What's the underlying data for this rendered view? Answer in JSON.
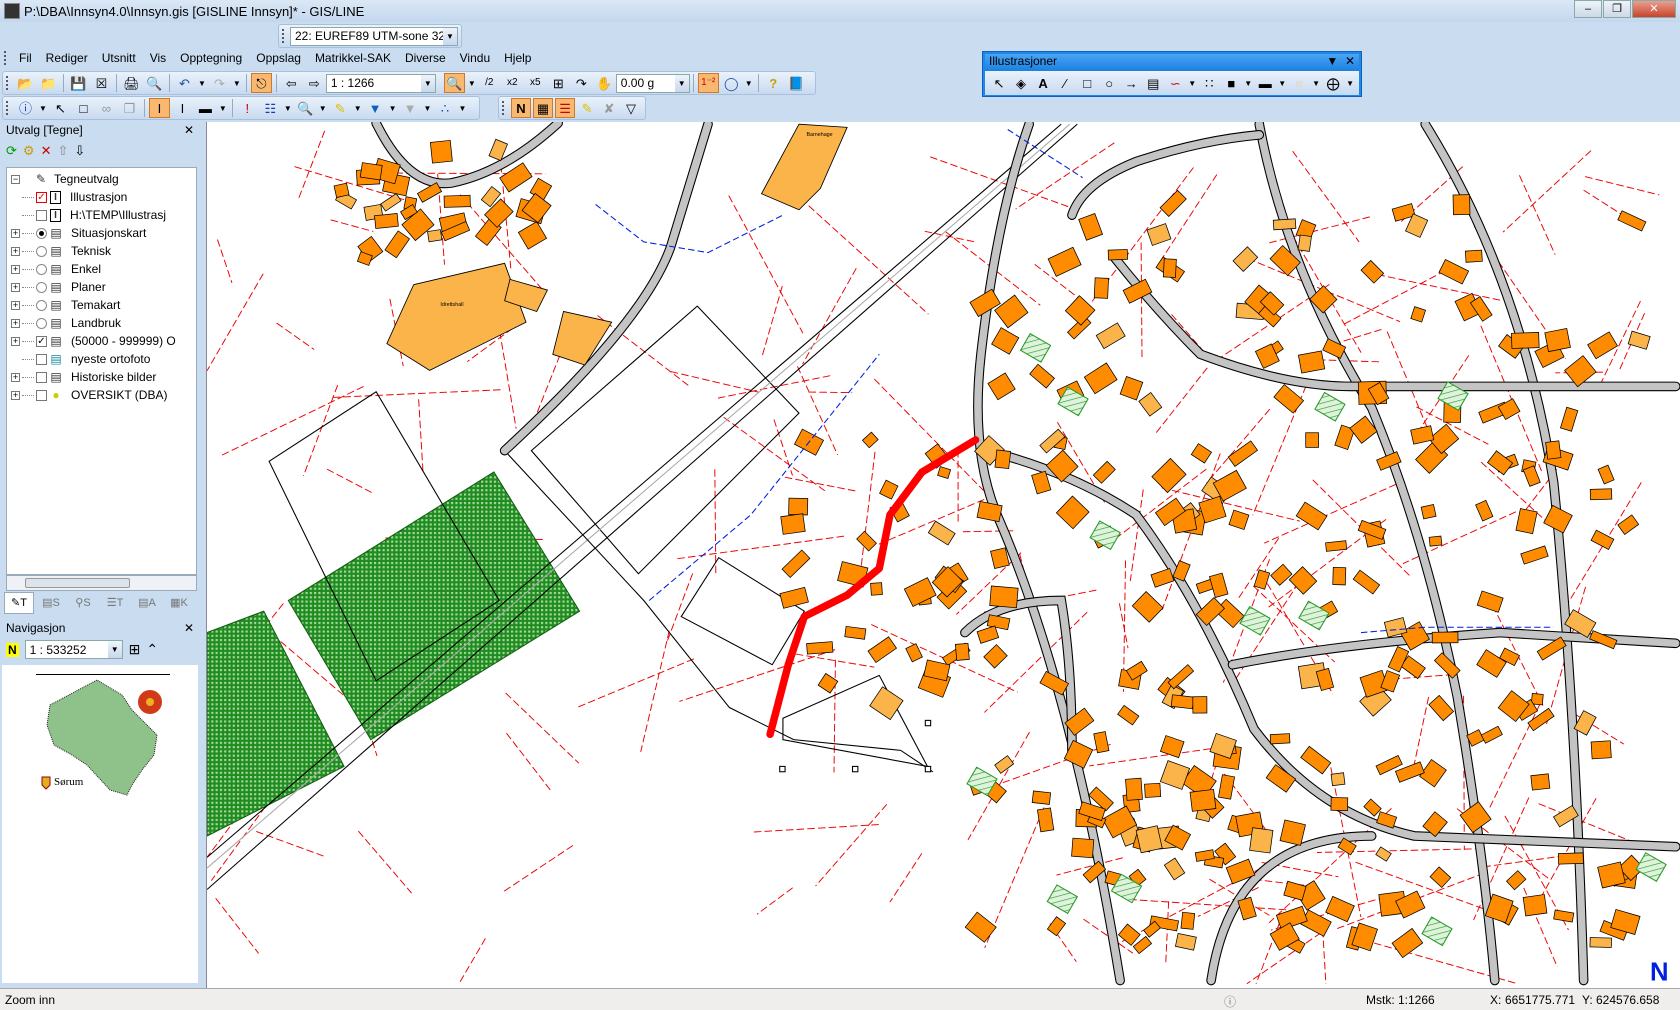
{
  "window": {
    "title": "P:\\DBA\\Innsyn4.0\\Innsyn.gis [GISLINE Innsyn]* - GIS/LINE"
  },
  "coord_system": {
    "value": "22: EUREF89 UTM-sone 32"
  },
  "menu": [
    "Fil",
    "Rediger",
    "Utsnitt",
    "Vis",
    "Opptegning",
    "Oppslag",
    "Matrikkel-SAK",
    "Diverse",
    "Vindu",
    "Hjelp"
  ],
  "toolbar": {
    "scale": "1 : 1266",
    "rotation": "0.00 g"
  },
  "illustrasjoner": {
    "title": "Illustrasjoner"
  },
  "utvalg": {
    "title": "Utvalg [Tegne]",
    "root": "Tegneutvalg",
    "items": [
      {
        "label": "Illustrasjon",
        "state": "checked-red"
      },
      {
        "label": "H:\\TEMP\\Illustrasj",
        "state": "unchecked"
      },
      {
        "label": "Situasjonskart",
        "state": "radio-on"
      },
      {
        "label": "Teknisk",
        "state": "radio-off"
      },
      {
        "label": "Enkel",
        "state": "radio-off"
      },
      {
        "label": "Planer",
        "state": "radio-off"
      },
      {
        "label": "Temakart",
        "state": "radio-off"
      },
      {
        "label": "Landbruk",
        "state": "radio-off"
      },
      {
        "label": "(50000 - 999999) O",
        "state": "checked"
      },
      {
        "label": "nyeste ortofoto",
        "state": "unchecked"
      },
      {
        "label": "Historiske bilder",
        "state": "unchecked"
      },
      {
        "label": "OVERSIKT (DBA)",
        "state": "unchecked"
      }
    ],
    "tabs": [
      "T",
      "S",
      "S",
      "T",
      "A",
      "K"
    ]
  },
  "navigasjon": {
    "title": "Navigasjon",
    "scale": "1 : 533252",
    "logo_text": "Sørum"
  },
  "map": {
    "labels": [
      "Barnehage",
      "Idrettshall"
    ],
    "route_color": "#ff0000",
    "building_color": "#ff8c00",
    "green_area_color": "#1e8c1e"
  },
  "status": {
    "message": "Zoom inn",
    "mstk_label": "Mstk:",
    "mstk": "1:1266",
    "x_label": "X:",
    "x": "6651775.771",
    "y_label": "Y:",
    "y": "624576.658"
  }
}
